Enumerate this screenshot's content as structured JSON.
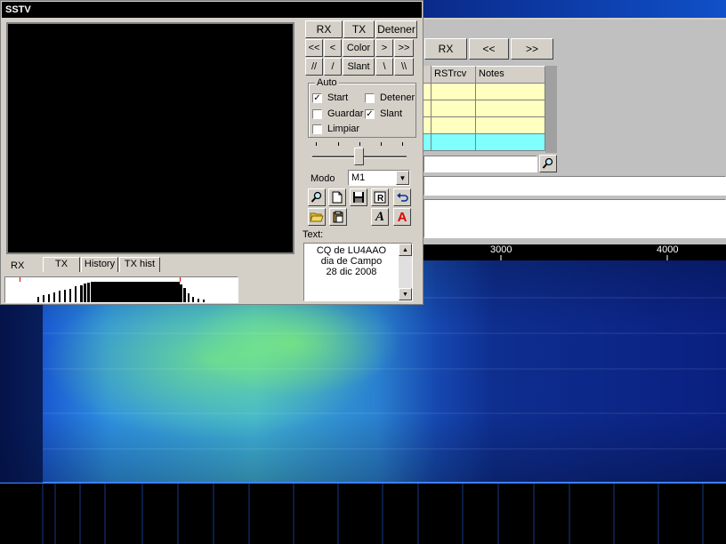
{
  "sstv": {
    "title": "SSTV",
    "rx_button": "RX",
    "tx_button": "TX",
    "stop_button": "Detener",
    "color_button": "Color",
    "slant_button": "Slant",
    "nav_first": "<<",
    "nav_prev": "<",
    "nav_next": ">",
    "nav_last": ">>",
    "slant_ll": "//",
    "slant_l": "/",
    "slant_r": "\\",
    "slant_rr": "\\\\",
    "auto_label": "Auto",
    "auto_start": "Start",
    "auto_stop": "Detener",
    "auto_save": "Guardar",
    "auto_slant": "Slant",
    "auto_clear": "Limpiar",
    "mode_label": "Modo",
    "mode_value": "M1",
    "text_label": "Text:",
    "text_lines": [
      "CQ de LU4AAO",
      "dia de Campo",
      "28 dic 2008"
    ],
    "tabs": {
      "rx": "RX",
      "tx": "TX",
      "history": "History",
      "tx_hist": "TX hist"
    },
    "checks": {
      "start": true,
      "stop": false,
      "save": false,
      "slant": true,
      "clear": false
    }
  },
  "main": {
    "rx_button": "RX",
    "prev_button": "<<",
    "next_button": ">>",
    "log_headers": [
      "RSTrcv",
      "Notes"
    ],
    "freq_ticks": [
      "3000",
      "4000"
    ]
  }
}
